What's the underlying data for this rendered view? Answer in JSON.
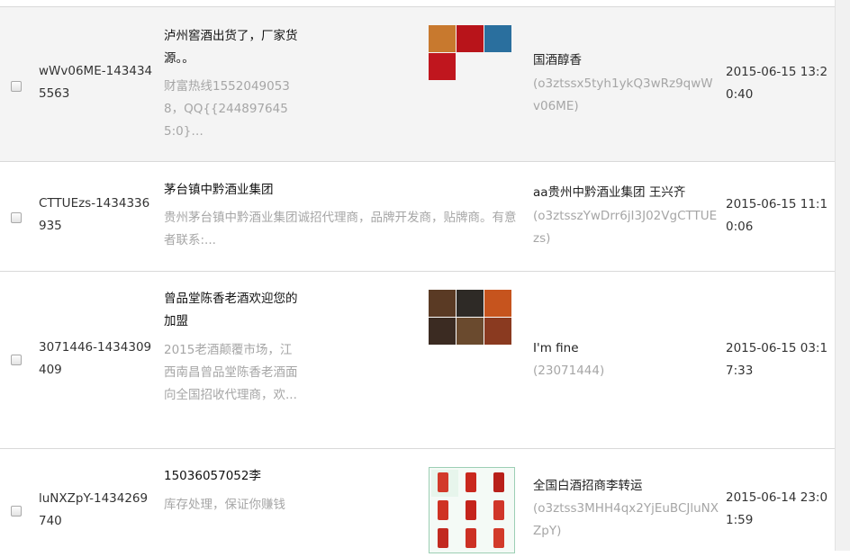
{
  "rows": [
    {
      "user_id": "wWv06ME-1434345563",
      "title": "泸州窖酒出货了，厂家货源。。",
      "desc": "财富热线15520490538，QQ{{2448976455:0}…",
      "sender": "国酒醇香",
      "openid": "(o3ztssx5tyh1ykQ3wRz9qwWv06ME)",
      "time": "2015-06-15 13:20:40",
      "thumb_colors": [
        "#c8792e",
        "#b8141a",
        "#2a6f9e",
        "#c0161e"
      ]
    },
    {
      "user_id": "CTTUEzs-1434336935",
      "title": "茅台镇中黔酒业集团",
      "desc": "贵州茅台镇中黔酒业集团诚招代理商，品牌开发商，贴牌商。有意者联系:...",
      "sender": "aa贵州中黔酒业集团 王兴齐",
      "openid": "(o3ztsszYwDrr6jI3J02VgCTTUEzs)",
      "time": "2015-06-15 11:10:06",
      "thumb_colors": []
    },
    {
      "user_id": "3071446-1434309409",
      "title": "曾品堂陈香老酒欢迎您的加盟",
      "desc": "2015老酒颠覆市场，江西南昌曾品堂陈香老酒面向全国招收代理商，欢...",
      "sender": "I'm fine",
      "openid": "(23071444)",
      "time": "2015-06-15 03:17:33",
      "thumb_colors": [
        "#5a3a24",
        "#2e2a26",
        "#c6541e",
        "#3b2b22",
        "#6a4a2e",
        "#8a3a20",
        "#3a3a3a",
        "#7a5a3a",
        "#b04a22"
      ]
    },
    {
      "user_id": "luNXZpY-1434269740",
      "title": "15036057052李",
      "desc": "库存处理，保证你赚钱",
      "sender": "全国白酒招商李转运",
      "openid": "(o3ztss3MHH4qx2YjEuBCJluNXZpY)",
      "time": "2015-06-14 23:01:59",
      "thumb_colors": [
        "#d23a2a",
        "#c9281e",
        "#b8201a",
        "#cf3224",
        "#c4241c",
        "#d0362a",
        "#c22a20",
        "#cc3024",
        "#d23a2a"
      ]
    }
  ]
}
